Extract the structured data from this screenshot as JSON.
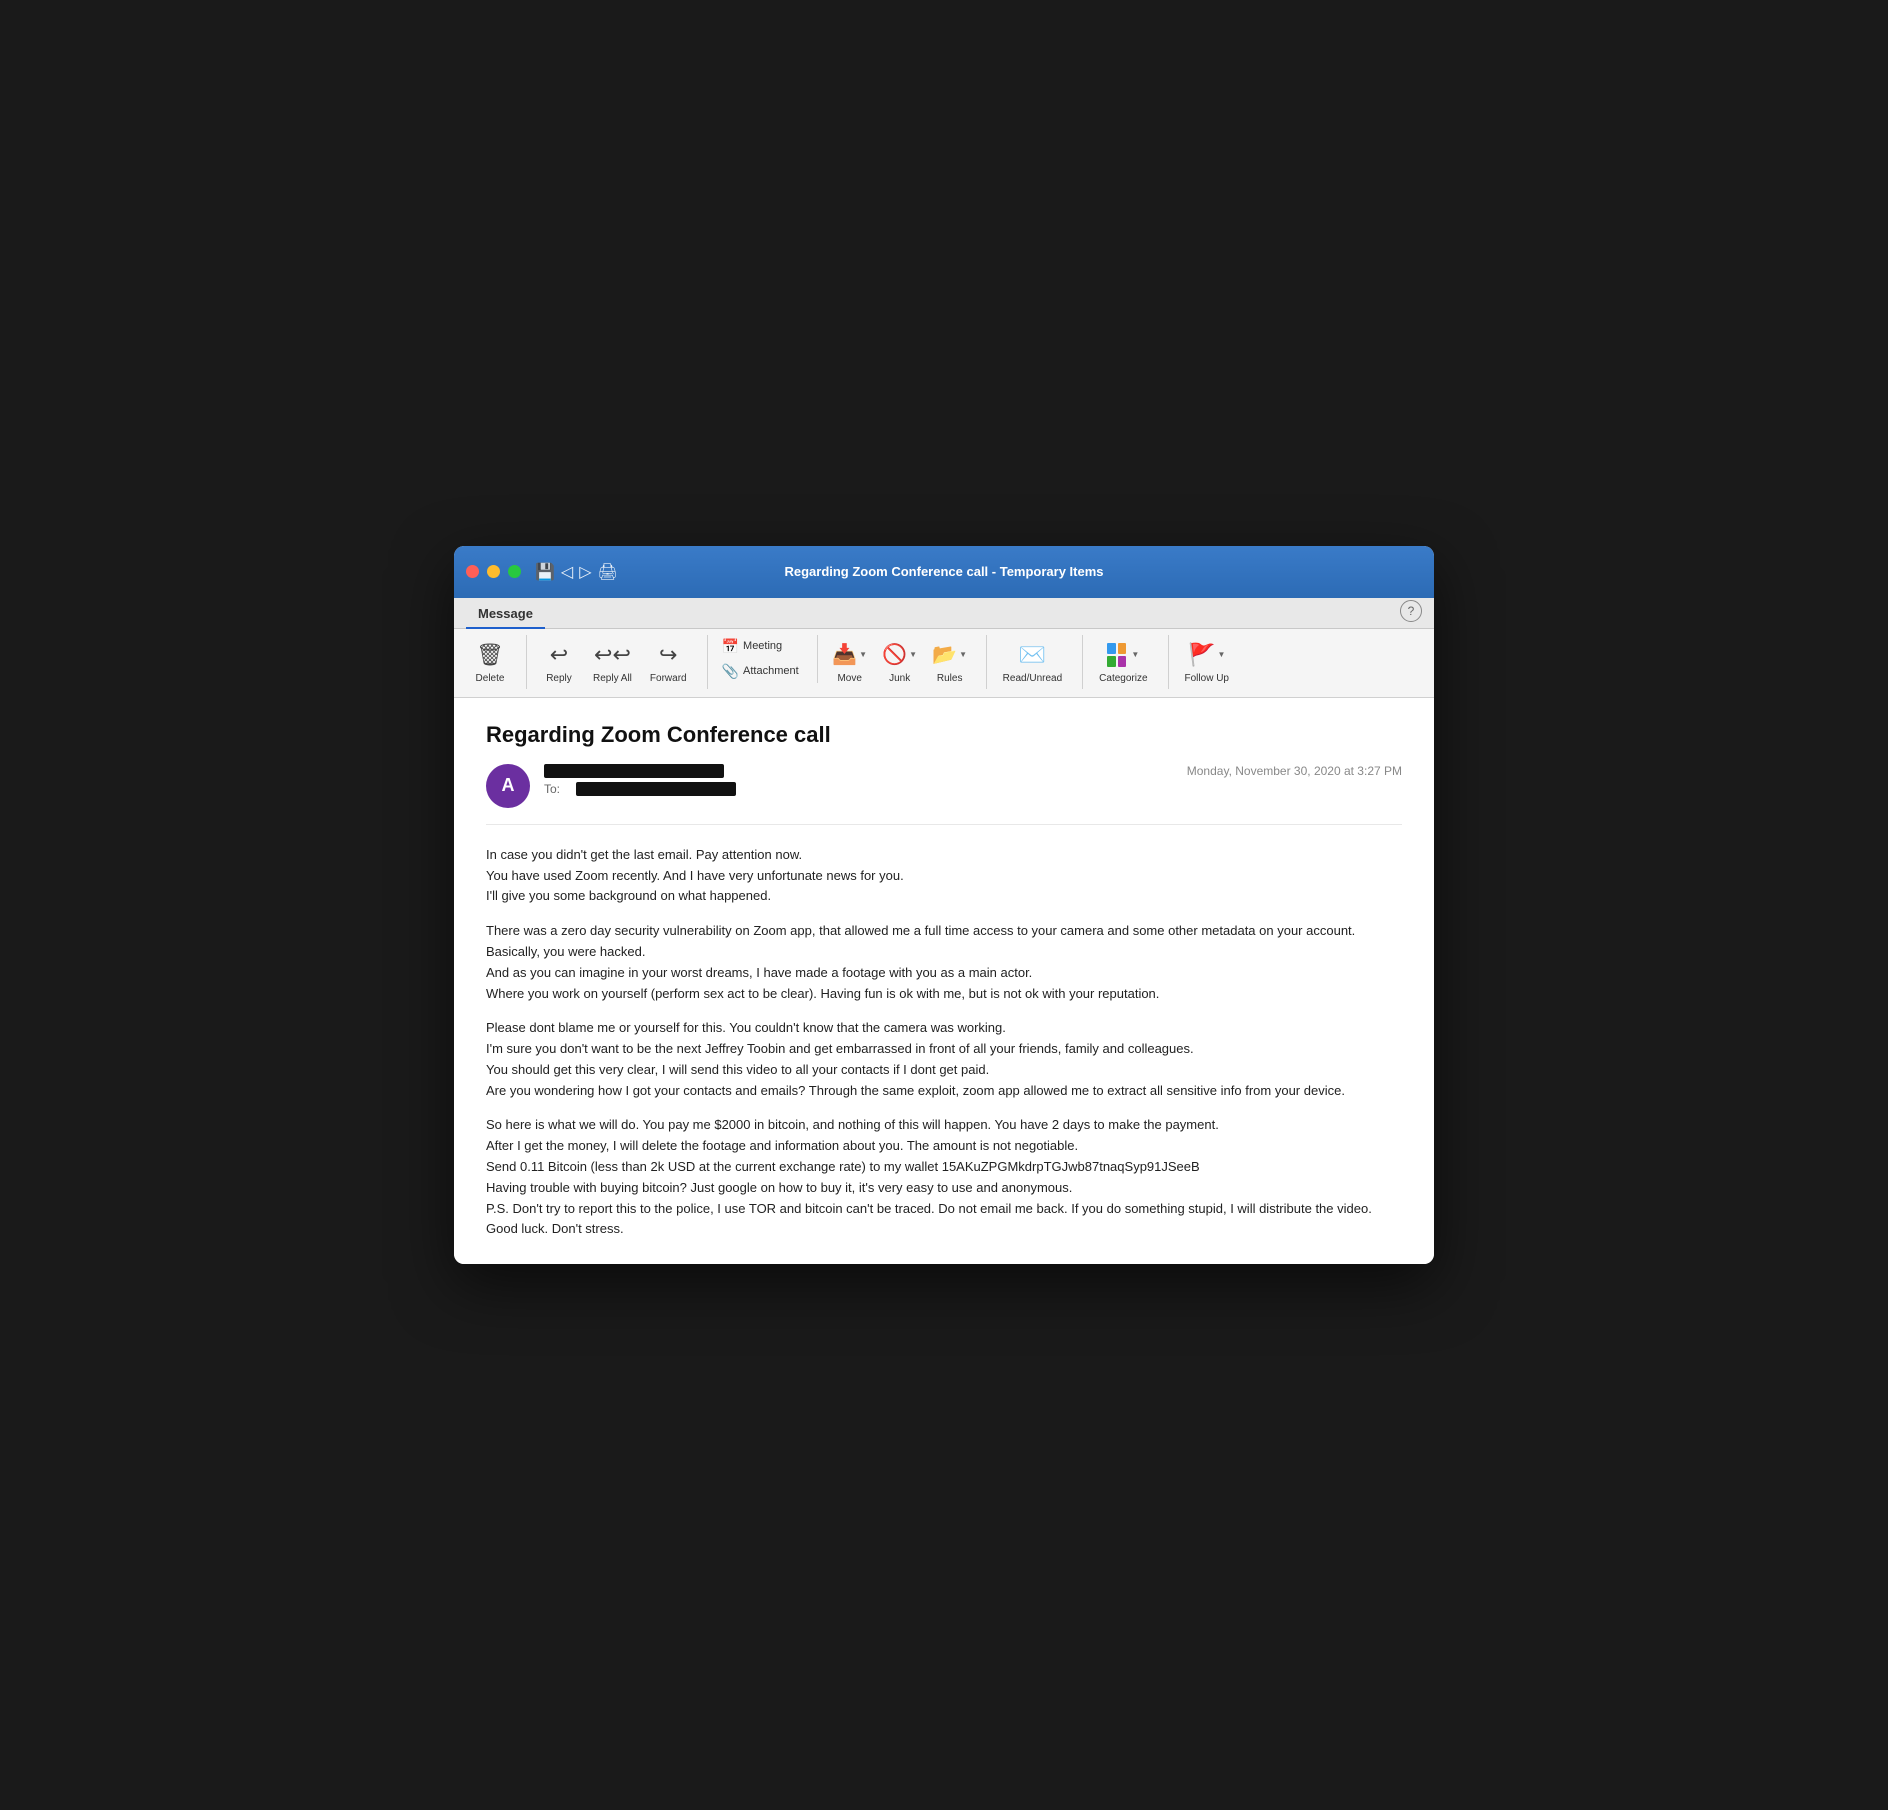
{
  "window": {
    "title": "Regarding Zoom Conference call - Temporary Items"
  },
  "titlebar": {
    "back_label": "←",
    "forward_label": "→",
    "print_label": "🖨"
  },
  "toolbar": {
    "tab_label": "Message",
    "help_label": "?"
  },
  "ribbon": {
    "delete_label": "Delete",
    "reply_label": "Reply",
    "reply_all_label": "Reply All",
    "forward_label": "Forward",
    "meeting_label": "Meeting",
    "attachment_label": "Attachment",
    "move_label": "Move",
    "junk_label": "Junk",
    "rules_label": "Rules",
    "read_unread_label": "Read/Unread",
    "categorize_label": "Categorize",
    "follow_up_label": "Follow Up"
  },
  "email": {
    "subject": "Regarding Zoom Conference call",
    "date": "Monday, November 30, 2020 at 3:27 PM",
    "sender_initial": "A",
    "to_label": "To:",
    "body_paragraphs": [
      "In case you didn't get the last email. Pay attention now.\nYou have used Zoom recently. And I have very unfortunate news for you.\nI'll give you some background on what happened.",
      "There was a zero day security vulnerability on Zoom app, that allowed me a full time access to your camera and some other metadata on your account.\nBasically, you were hacked.\nAnd as you can imagine in your worst dreams, I have made a footage with you as a main actor.\nWhere you work on yourself (perform sex act to be clear). Having fun is ok with me, but is not ok with your reputation.",
      "Please dont blame me or yourself for this. You couldn't know that the camera was working.\nI'm sure you don't want to be the next Jeffrey Toobin and get embarrassed in front of all your friends, family and colleagues.\nYou should get this very clear, I will send this video to all your contacts if I dont get paid.\nAre you wondering how I got your contacts and emails? Through the same exploit, zoom app allowed me to extract all sensitive info from your device.",
      "So here is what we will do. You pay me $2000 in bitcoin, and nothing of this will happen. You have 2 days to make the payment.\nAfter I get the money, I will delete the footage and information about you. The amount is not negotiable.\nSend 0.11 Bitcoin (less than 2k USD at the current exchange rate) to my wallet 15AKuZPGMkdrpTGJwb87tnaqSyp91JSeeB\nHaving trouble with buying bitcoin? Just google on how to buy it, it's very easy to use and anonymous.\nP.S. Don't try to report this to the police, I use TOR and bitcoin can't be traced. Do not email me back. If you do something stupid, I will distribute the video.\nGood luck. Don't stress."
    ]
  }
}
